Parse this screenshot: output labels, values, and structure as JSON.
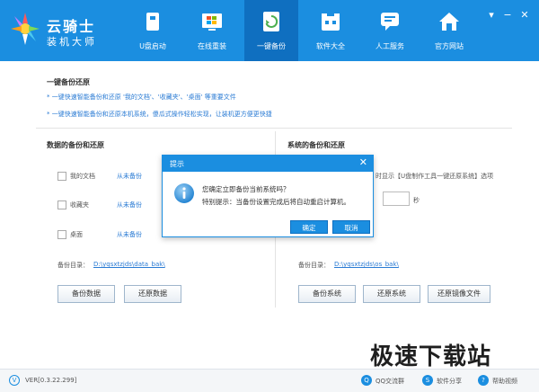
{
  "app": {
    "title": "云骑士",
    "subtitle": "装机大师"
  },
  "nav": {
    "items": [
      {
        "label": "U盘启动",
        "icon": "usb-drive-icon"
      },
      {
        "label": "在线重装",
        "icon": "windows-icon"
      },
      {
        "label": "一键备份",
        "icon": "backup-icon"
      },
      {
        "label": "软件大全",
        "icon": "software-icon"
      },
      {
        "label": "人工服务",
        "icon": "chat-icon"
      },
      {
        "label": "官方网站",
        "icon": "home-icon"
      }
    ]
  },
  "window_controls": {
    "menu": "▾",
    "minimize": "−",
    "close": "✕"
  },
  "main": {
    "title": "一键备份还原",
    "note1": "* 一键快速智能备份和还原 '我的文档'、'收藏夹'、'桌面' 等重要文件",
    "note2": "* 一键快速智能备份和还原本机系统，傻瓜式操作轻松实现，让装机更方便更快捷"
  },
  "data_backup": {
    "title": "数据的备份和还原",
    "items": [
      {
        "label": "我的文档",
        "status": "从未备份"
      },
      {
        "label": "收藏夹",
        "status": "从未备份"
      },
      {
        "label": "桌面",
        "status": "从未备份"
      }
    ],
    "dir_label": "备份目录：",
    "dir_path": "D:\\yqsxtzjds\\data_bak\\",
    "backup_button": "备份数据",
    "restore_button": "还原数据"
  },
  "system_backup": {
    "title": "系统的备份和还原",
    "option_text": "时显示【U盘制作工具一键还原系统】选项",
    "seconds_unit": "秒",
    "dir_label": "备份目录：",
    "dir_path": "D:\\yqsxtzjds\\os_bak\\",
    "backup_button": "备份系统",
    "restore_button": "还原系统",
    "restore_image_button": "还原镜像文件"
  },
  "dialog": {
    "title": "提示",
    "close": "✕",
    "message1": "您确定立即备份当前系统吗？",
    "message2": "特别提示：当备份设置完成后将自动重启计算机。",
    "ok": "确定",
    "cancel": "取消"
  },
  "footer": {
    "version_icon": "V",
    "version": "VER[0.3.22.299]",
    "qq": "QQ交流群",
    "share": "软件分享",
    "help": "帮助视频"
  },
  "watermark": "极速下载站",
  "colors": {
    "header": "#1b8ee0",
    "active_tab": "#0f6fc0",
    "link": "#2a7bd4"
  }
}
